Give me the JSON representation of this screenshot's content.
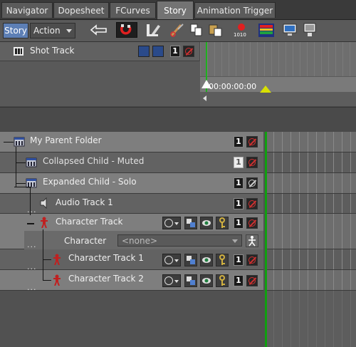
{
  "tabs": [
    {
      "label": "Navigator",
      "active": false
    },
    {
      "label": "Dopesheet",
      "active": false
    },
    {
      "label": "FCurves",
      "active": false
    },
    {
      "label": "Story",
      "active": true
    },
    {
      "label": "Animation Trigger",
      "active": false
    }
  ],
  "toolbar": {
    "mode_story": "Story",
    "mode_action": "Action",
    "icons": [
      "undo-arrow-icon",
      "magnet-icon",
      "ripple-edit-icon",
      "razor-icon",
      "copy-icon",
      "paste-icon",
      "record-icon",
      "render-icon",
      "camera-view-icon",
      "camera-switch-icon"
    ]
  },
  "shot_track": {
    "label": "Shot Track",
    "lock_label": "1"
  },
  "time": {
    "current": "00:00:00:00"
  },
  "tracks": {
    "parent": {
      "label": "My Parent Folder",
      "lock_label": "1"
    },
    "collapsed": {
      "label": "Collapsed Child - Muted",
      "lock_label": "1"
    },
    "expanded": {
      "label": "Expanded Child - Solo",
      "lock_label": "1"
    },
    "audio": {
      "label": "Audio Track 1",
      "lock_label": "1"
    },
    "character": {
      "label": "Character Track",
      "lock_label": "1",
      "property_label": "Character",
      "property_value": "<none>"
    },
    "char1": {
      "label": "Character Track 1",
      "lock_label": "1"
    },
    "char2": {
      "label": "Character Track 2",
      "lock_label": "1"
    }
  },
  "dots": "..."
}
